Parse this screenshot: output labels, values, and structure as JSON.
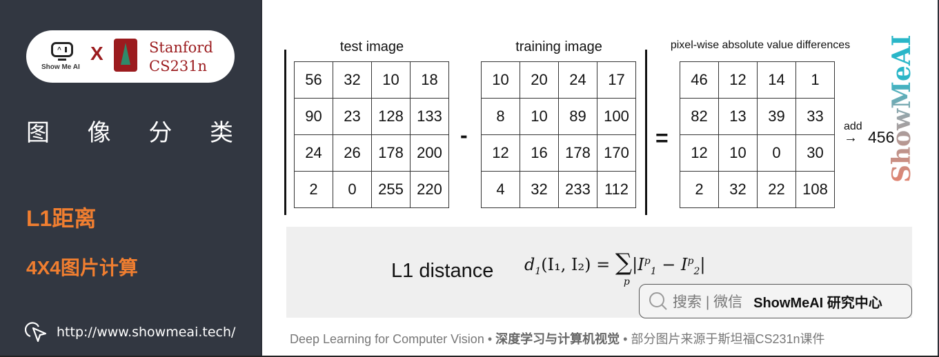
{
  "sidebar": {
    "logo": {
      "showmeai_text": "Show Me AI",
      "times": "X",
      "stanford_line1": "Stanford",
      "stanford_line2": "CS231n"
    },
    "section_title_chars": [
      "图",
      "像",
      "分",
      "类"
    ],
    "topic": "L1距离",
    "subtopic": "4X4图片计算",
    "url": "http://www.showmeai.tech/"
  },
  "main": {
    "test_image": {
      "label": "test image",
      "rows": [
        [
          56,
          32,
          10,
          18
        ],
        [
          90,
          23,
          128,
          133
        ],
        [
          24,
          26,
          178,
          200
        ],
        [
          2,
          0,
          255,
          220
        ]
      ]
    },
    "minus": "-",
    "training_image": {
      "label": "training image",
      "rows": [
        [
          10,
          20,
          24,
          17
        ],
        [
          8,
          10,
          89,
          100
        ],
        [
          12,
          16,
          178,
          170
        ],
        [
          4,
          32,
          233,
          112
        ]
      ]
    },
    "equals": "=",
    "differences": {
      "label": "pixel-wise absolute value differences",
      "rows": [
        [
          46,
          12,
          14,
          1
        ],
        [
          82,
          13,
          39,
          33
        ],
        [
          12,
          10,
          0,
          30
        ],
        [
          2,
          32,
          22,
          108
        ]
      ]
    },
    "add_label": "add",
    "arrow": "→",
    "result": "456",
    "watermark": "ShowMeAI",
    "formula_label": "L1 distance",
    "formula": {
      "lhs": "d",
      "lhs_sub": "1",
      "args": "(I₁, I₂) =",
      "sum": "∑",
      "sum_sub": "p",
      "body_open": "|I",
      "sub1": "1",
      "sup1": "p",
      "minus": " − I",
      "sub2": "2",
      "sup2": "p",
      "body_close": "|"
    },
    "search": {
      "placeholder": "搜索 | 微信",
      "brand": "ShowMeAI 研究中心"
    },
    "footer": {
      "part1": "Deep Learning for Computer Vision",
      "sep1": " • ",
      "part2": "深度学习与计算机视觉",
      "sep2": " • ",
      "part3": "部分图片来源于斯坦福CS231n课件"
    }
  }
}
